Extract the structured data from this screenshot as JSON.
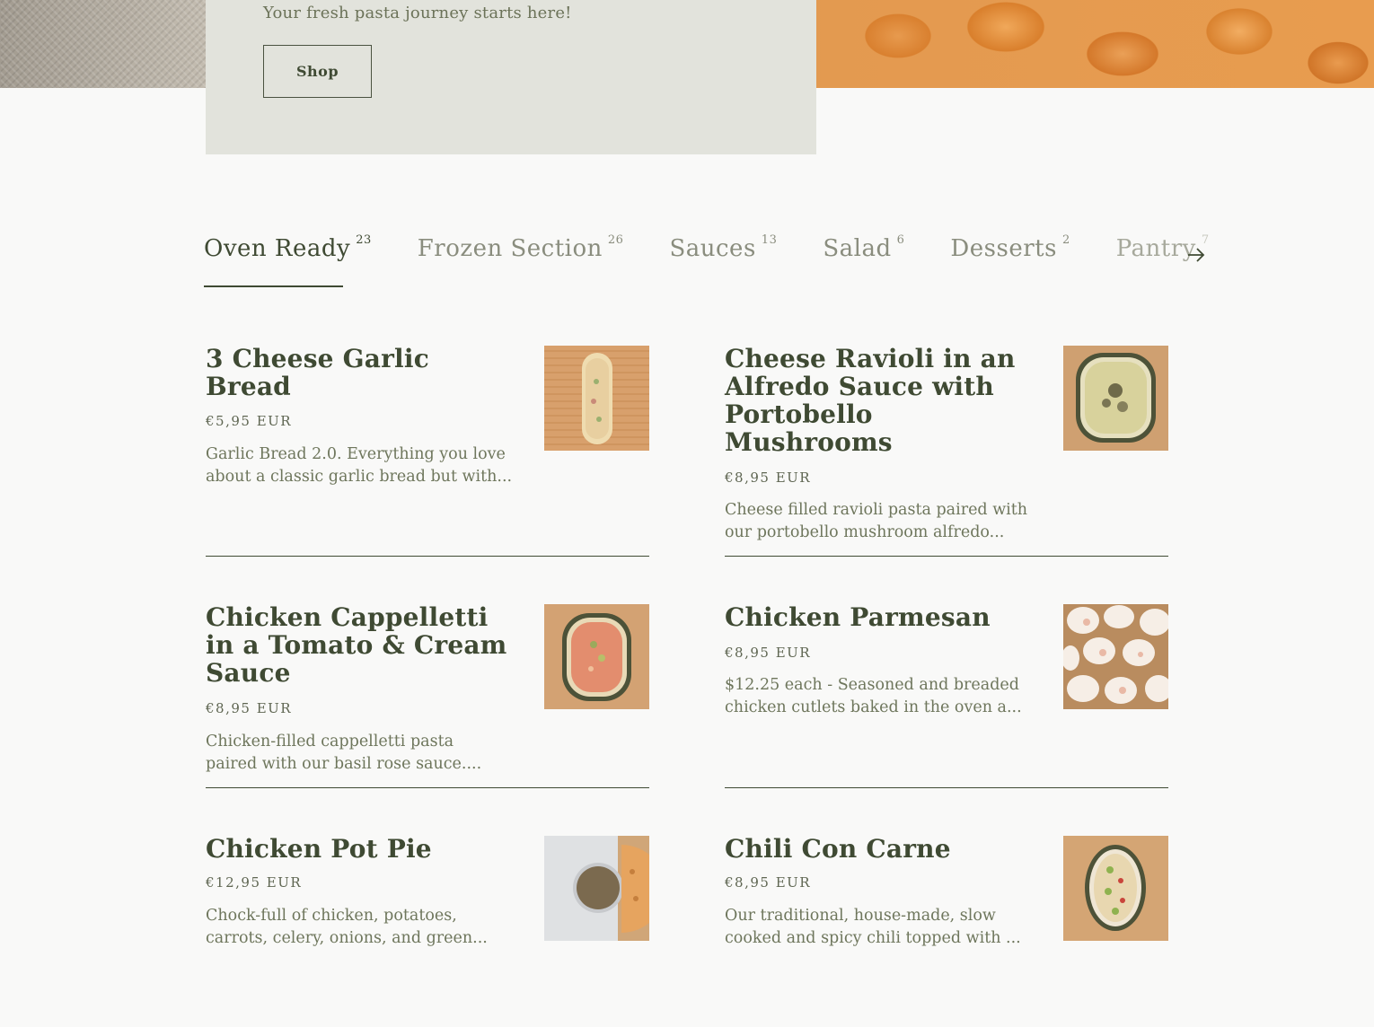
{
  "hero": {
    "subtitle": "Your fresh pasta journey starts here!",
    "shop_label": "Shop"
  },
  "tabs": [
    {
      "label": "Oven Ready",
      "count": "23",
      "active": true
    },
    {
      "label": "Frozen Section",
      "count": "26"
    },
    {
      "label": "Sauces",
      "count": "13"
    },
    {
      "label": "Salad",
      "count": "6"
    },
    {
      "label": "Desserts",
      "count": "2"
    },
    {
      "label": "Pantry",
      "count": "7"
    }
  ],
  "next_icon": "arrow-right-icon",
  "products": [
    {
      "name": "3 Cheese Garlic Bread",
      "price": "€5,95 EUR",
      "desc1": "Garlic Bread 2.0. Everything you love",
      "desc2": "about a classic garlic bread but with..."
    },
    {
      "name": "Cheese Ravioli in an Alfredo Sauce with Portobello Mushrooms",
      "price": "€8,95 EUR",
      "desc1": "Cheese filled ravioli pasta paired with",
      "desc2": "our portobello mushroom alfredo..."
    },
    {
      "name": "Chicken Cappelletti in a Tomato & Cream Sauce",
      "price": "€8,95 EUR",
      "desc1": "Chicken-filled cappelletti pasta",
      "desc2": "paired with our basil rose sauce...."
    },
    {
      "name": "Chicken Parmesan",
      "price": "€8,95 EUR",
      "desc1": "$12.25 each - Seasoned and breaded",
      "desc2": "chicken cutlets baked in the oven a..."
    },
    {
      "name": "Chicken Pot Pie",
      "price": "€12,95 EUR",
      "desc1": "Chock-full of chicken, potatoes,",
      "desc2": "carrots, celery, onions, and green..."
    },
    {
      "name": "Chili Con Carne",
      "price": "€8,95 EUR",
      "desc1": "Our traditional, house-made, slow",
      "desc2": "cooked and spicy chili topped with ..."
    }
  ],
  "colors": {
    "accent": "#3f4a33",
    "background": "#f9f9f8",
    "card": "#e2e3dc"
  }
}
